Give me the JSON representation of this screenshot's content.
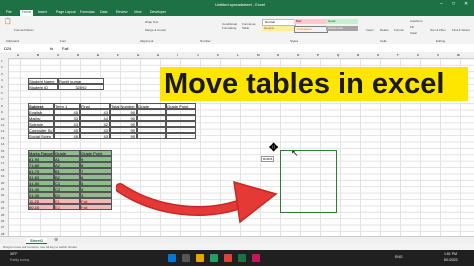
{
  "window": {
    "title": "Untitled spreadsheet - Excel"
  },
  "tabs": [
    "File",
    "Home",
    "Insert",
    "Page Layout",
    "Formulas",
    "Data",
    "Review",
    "View",
    "Developer"
  ],
  "ribbon": {
    "wrap_text": "Wrap Text",
    "merge_center": "Merge & Center",
    "format_painter": "Format Painter",
    "conditional_formatting": "Conditional Formatting",
    "format_as_table": "Format as Table",
    "styles": {
      "normal": "Normal",
      "bad": "Bad",
      "good": "Good",
      "neutral": "Neutral",
      "calculation": "Calculation",
      "check_cell": "Check Cell"
    },
    "insert": "Insert",
    "delete": "Delete",
    "format": "Format",
    "autosum": "AutoSum",
    "fill": "Fill",
    "clear": "Clear",
    "sort_filter": "Sort & Filter",
    "find_select": "Find & Select",
    "groups": {
      "clipboard": "Clipboard",
      "font": "Font",
      "alignment": "Alignment",
      "number": "Number",
      "styles": "Styles",
      "cells": "Cells",
      "editing": "Editing"
    }
  },
  "formula_bar": {
    "name_box": "D24",
    "fx": "fx",
    "value": "Fail"
  },
  "student_table": [
    [
      "Student Name",
      "Ronjit kumar"
    ],
    [
      "Student ID",
      "32092"
    ]
  ],
  "subject_table": {
    "headers": [
      "Subject",
      "Term 1",
      "Final",
      "Total Number",
      "Grade",
      "Grade Point"
    ],
    "rows": [
      [
        "English",
        "45",
        "43",
        "90"
      ],
      [
        "Maths",
        "33",
        "44",
        "90"
      ],
      [
        "Science",
        "43",
        "42",
        "90"
      ],
      [
        "Computer Sc",
        "45",
        "43",
        "90"
      ],
      [
        "Social Scien",
        "45",
        "43",
        "90"
      ]
    ]
  },
  "grade_table": {
    "headers": [
      "Marks Range",
      "Grade",
      "Grade Point"
    ],
    "rows": [
      [
        "81-90",
        "A1",
        "9"
      ],
      [
        "71-80",
        "A2",
        "8"
      ],
      [
        "61-70",
        "B1",
        "7"
      ],
      [
        "51-60",
        "B2",
        "6"
      ],
      [
        "41-50",
        "C1",
        "5"
      ],
      [
        "31-40",
        "C2",
        "4"
      ],
      [
        "21-30",
        "D1",
        "3"
      ],
      [
        "11-20",
        "E1",
        "Fail"
      ],
      [
        "00-10",
        "E2",
        "Fail"
      ]
    ]
  },
  "headline": "Move tables in excel",
  "drag_tooltip": "R16C5",
  "sheet_tab": "Sheet1",
  "status_text": "Drag to move cell contents, use Alt key to switch sheets",
  "taskbar": {
    "weather": "30°F",
    "weather_sub": "Partly sunny",
    "time": "1:51 PM",
    "date": "8/1/2023",
    "lang": "ENG"
  },
  "colors": {
    "excel_green": "#1e7145",
    "highlight": "#ffe600",
    "arrow": "#e53935",
    "grade_fill": "#8fbc8f",
    "fail_fill": "#f4b6b6"
  }
}
